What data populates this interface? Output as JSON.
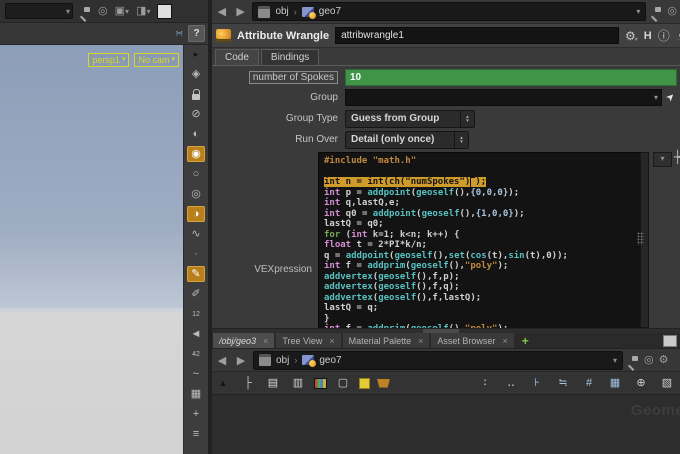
{
  "colors": {
    "param_green": "#3f9447",
    "selection_orange": "#cf9b2a",
    "toggle_orange": "#b87f1a",
    "viewport_label_yellow": "#d8d824",
    "add_tab_green": "#86c440"
  },
  "left_pane": {
    "help_label": "?",
    "viewport": {
      "camera_label": "persp1",
      "cam_link_label": "No cam"
    },
    "vp_toolbar": [
      {
        "name": "toolbar-overflow-icon",
        "glyph": "▸",
        "cls": "dark"
      },
      {
        "name": "gem-display-icon",
        "glyph": "◈"
      },
      {
        "name": "lock-icon",
        "glyph": "",
        "cls": "lock"
      },
      {
        "name": "headlight-only-icon",
        "glyph": "⊘"
      },
      {
        "name": "normal-lighting-icon",
        "glyph": "◐"
      },
      {
        "name": "high-quality-lighting-icon",
        "glyph": "◉",
        "active": true
      },
      {
        "name": "point-light-icon",
        "glyph": "○"
      },
      {
        "name": "cone-light-icon",
        "glyph": "◎"
      },
      {
        "name": "smooth-shaded-icon",
        "glyph": "◑",
        "active": true
      },
      {
        "name": "snap-mode-icon",
        "glyph": "∿"
      },
      {
        "name": "point-display-icon",
        "glyph": "·"
      },
      {
        "name": "marker-brush-icon",
        "glyph": "✎",
        "active": true
      },
      {
        "name": "eyedropper-icon",
        "glyph": "✐"
      },
      {
        "name": "point-numbers-icon",
        "glyph": "12",
        "cls": "txt"
      },
      {
        "name": "vertex-markers-icon",
        "glyph": "◄"
      },
      {
        "name": "prim-numbers-icon",
        "glyph": "42",
        "cls": "txt"
      },
      {
        "name": "curve-hull-icon",
        "glyph": "~"
      },
      {
        "name": "template-grid-icon",
        "glyph": "▦"
      },
      {
        "name": "origin-axes-icon",
        "glyph": "+"
      },
      {
        "name": "layer-disc-icon",
        "glyph": "≡"
      }
    ]
  },
  "param_pane": {
    "path": {
      "root": "obj",
      "node": "geo7"
    },
    "header": {
      "type_label": "Attribute Wrangle",
      "name_value": "attribwrangle1",
      "houdini_badge": "H"
    },
    "tabs": [
      {
        "label": "Code",
        "active": true
      },
      {
        "label": "Bindings",
        "active": false
      }
    ],
    "params": [
      {
        "label": "number of Spokes",
        "value": "10"
      },
      {
        "label": "Group",
        "value": ""
      },
      {
        "label": "Group Type",
        "value": "Guess from Group"
      },
      {
        "label": "Run Over",
        "value": "Detail (only once)"
      }
    ],
    "vex_label": "VEXpression",
    "code": {
      "lines": [
        [
          {
            "c": "pp",
            "t": "#include \"math.h\""
          }
        ],
        [],
        [
          {
            "c": "sel",
            "t": "int n = int(ch(\"numSpokes\")"
          },
          {
            "c": "cursor",
            "t": ""
          },
          {
            "c": "sel",
            "t": ");"
          }
        ],
        [
          {
            "c": "kw",
            "t": "int"
          },
          {
            "c": "pl",
            "t": " p = "
          },
          {
            "c": "fn",
            "t": "addpoint"
          },
          {
            "c": "pl",
            "t": "("
          },
          {
            "c": "fn",
            "t": "geoself"
          },
          {
            "c": "pl",
            "t": "(),"
          },
          {
            "c": "num",
            "t": "{0,0,0}"
          },
          {
            "c": "pl",
            "t": ");"
          }
        ],
        [
          {
            "c": "kw",
            "t": "int"
          },
          {
            "c": "pl",
            "t": " q,lastQ,e;"
          }
        ],
        [
          {
            "c": "kw",
            "t": "int"
          },
          {
            "c": "pl",
            "t": " q0 = "
          },
          {
            "c": "fn",
            "t": "addpoint"
          },
          {
            "c": "pl",
            "t": "("
          },
          {
            "c": "fn",
            "t": "geoself"
          },
          {
            "c": "pl",
            "t": "(),"
          },
          {
            "c": "num",
            "t": "{1,0,0}"
          },
          {
            "c": "pl",
            "t": ");"
          }
        ],
        [
          {
            "c": "pl",
            "t": "lastQ = q0;"
          }
        ],
        [
          {
            "c": "kw2",
            "t": "for"
          },
          {
            "c": "pl",
            "t": " ("
          },
          {
            "c": "kw",
            "t": "int"
          },
          {
            "c": "pl",
            "t": " k=1; k<n; k++) {"
          }
        ],
        [
          {
            "c": "kw",
            "t": "float"
          },
          {
            "c": "pl",
            "t": " t = 2*PI*k/n;"
          }
        ],
        [
          {
            "c": "pl",
            "t": "q = "
          },
          {
            "c": "fn",
            "t": "addpoint"
          },
          {
            "c": "pl",
            "t": "("
          },
          {
            "c": "fn",
            "t": "geoself"
          },
          {
            "c": "pl",
            "t": "(),"
          },
          {
            "c": "fn",
            "t": "set"
          },
          {
            "c": "pl",
            "t": "("
          },
          {
            "c": "fn",
            "t": "cos"
          },
          {
            "c": "pl",
            "t": "(t),"
          },
          {
            "c": "fn",
            "t": "sin"
          },
          {
            "c": "pl",
            "t": "(t),0));"
          }
        ],
        [
          {
            "c": "kw",
            "t": "int"
          },
          {
            "c": "pl",
            "t": " f = "
          },
          {
            "c": "fn",
            "t": "addprim"
          },
          {
            "c": "pl",
            "t": "("
          },
          {
            "c": "fn",
            "t": "geoself"
          },
          {
            "c": "pl",
            "t": "(),"
          },
          {
            "c": "str",
            "t": "\"poly\""
          },
          {
            "c": "pl",
            "t": ");"
          }
        ],
        [
          {
            "c": "fn",
            "t": "addvertex"
          },
          {
            "c": "pl",
            "t": "("
          },
          {
            "c": "fn",
            "t": "geoself"
          },
          {
            "c": "pl",
            "t": "(),f,p);"
          }
        ],
        [
          {
            "c": "fn",
            "t": "addvertex"
          },
          {
            "c": "pl",
            "t": "("
          },
          {
            "c": "fn",
            "t": "geoself"
          },
          {
            "c": "pl",
            "t": "(),f,q);"
          }
        ],
        [
          {
            "c": "fn",
            "t": "addvertex"
          },
          {
            "c": "pl",
            "t": "("
          },
          {
            "c": "fn",
            "t": "geoself"
          },
          {
            "c": "pl",
            "t": "(),f,lastQ);"
          }
        ],
        [
          {
            "c": "pl",
            "t": "lastQ = q;"
          }
        ],
        [
          {
            "c": "pl",
            "t": "}"
          }
        ],
        [
          {
            "c": "kw",
            "t": "int"
          },
          {
            "c": "pl",
            "t": " f = "
          },
          {
            "c": "fn",
            "t": "addprim"
          },
          {
            "c": "pl",
            "t": "("
          },
          {
            "c": "fn",
            "t": "geoself"
          },
          {
            "c": "pl",
            "t": "(),"
          },
          {
            "c": "str",
            "t": "\"poly\""
          },
          {
            "c": "pl",
            "t": ");"
          }
        ]
      ]
    }
  },
  "bottom_pane": {
    "tabs": [
      {
        "label": "/obj/geo3",
        "active": true
      },
      {
        "label": "Tree View"
      },
      {
        "label": "Material Palette"
      },
      {
        "label": "Asset Browser"
      }
    ],
    "close_glyph": "×",
    "add_tab_label": "+",
    "path": {
      "root": "obj",
      "node": "geo7"
    },
    "watermark": "Geometr",
    "toolbar_left": [
      {
        "name": "pane-scroll-icon",
        "glyph": "▲",
        "cls": "dark"
      },
      {
        "name": "tree-view-icon",
        "glyph": "├",
        "color": "#cfcfcf"
      },
      {
        "name": "list-view-icon",
        "glyph": "▤",
        "color": "#d4dce4"
      },
      {
        "name": "node-parms-icon",
        "glyph": "▥",
        "color": "#cfcfcf"
      },
      {
        "name": "palette-icon",
        "glyph": "",
        "cls2": "i-palette"
      },
      {
        "name": "node-shape-icon",
        "glyph": "▢",
        "color": "#cfcfcf"
      },
      {
        "name": "sticky-note-icon",
        "glyph": "",
        "cls2": "i-sticky"
      },
      {
        "name": "bundle-basket-icon",
        "glyph": "",
        "cls2": "i-basket"
      }
    ],
    "toolbar_right": [
      {
        "name": "badge-display-icon",
        "glyph": "∶",
        "color": "#d8d8d8"
      },
      {
        "name": "name-display-icon",
        "glyph": "‥",
        "color": "#d8d8d8"
      },
      {
        "name": "snap-nodes-icon",
        "glyph": "⊦",
        "color": "#a4c4e0"
      },
      {
        "name": "align-nodes-icon",
        "glyph": "≒",
        "color": "#a4c4e0"
      },
      {
        "name": "grid-snap-icon",
        "glyph": "#",
        "color": "#a4c4e0"
      },
      {
        "name": "grid-display-icon",
        "glyph": "▦",
        "color": "#a4c4e0"
      },
      {
        "name": "zoom-search-icon",
        "glyph": "⊕",
        "color": "#d0d0d0"
      },
      {
        "name": "flag-image-icon",
        "glyph": "▧",
        "color": "#cfcfcf"
      }
    ]
  }
}
